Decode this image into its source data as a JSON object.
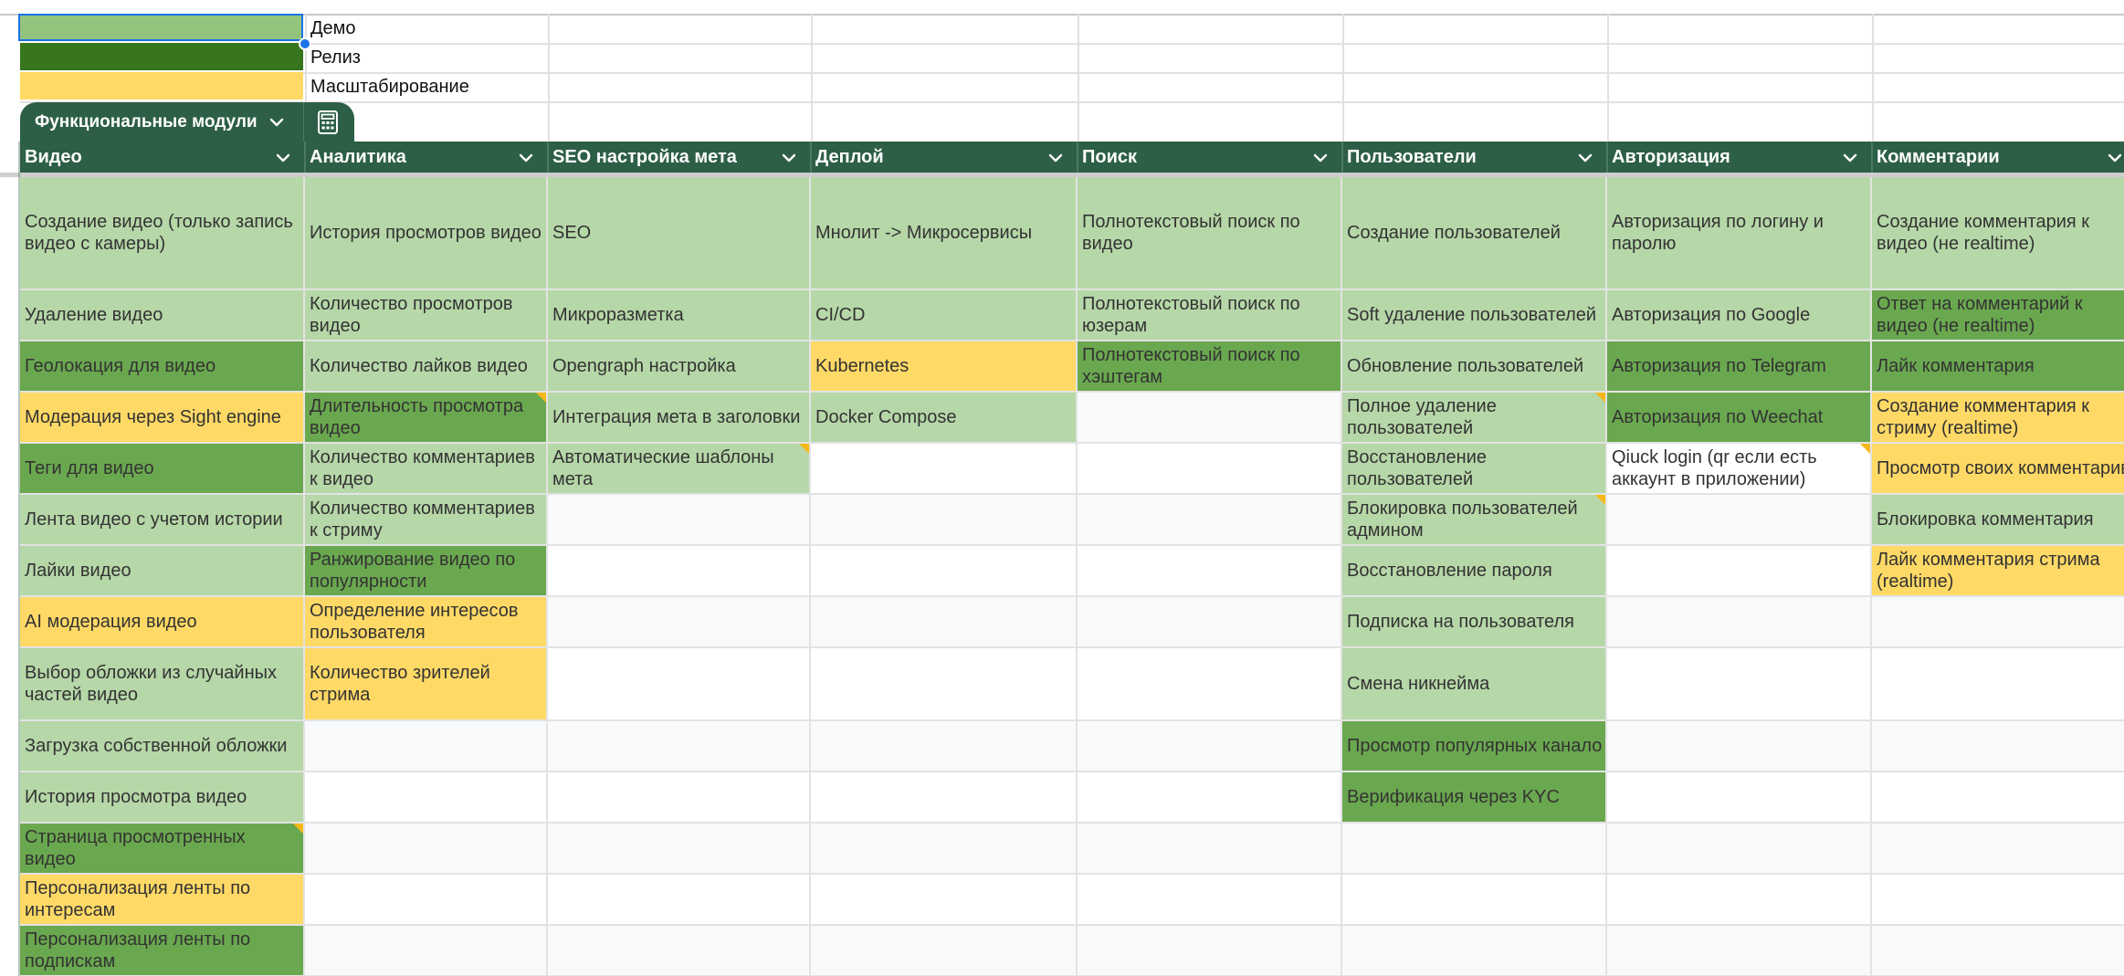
{
  "legend": [
    {
      "label": "Демо",
      "color": "#93c47d"
    },
    {
      "label": "Релиз",
      "color": "#38761d"
    },
    {
      "label": "Масштабирование",
      "color": "#ffd966"
    }
  ],
  "table": {
    "tab_label": "Функциональные модули",
    "tab_chevron_icon": "chevron-down-icon",
    "tab_calc_icon": "calculator-icon",
    "header_chevron_icon": "chevron-down-icon",
    "colors": {
      "header_bg": "#2d5f46",
      "demo": "#b6d7a8",
      "release": "#6aa84f",
      "scale": "#ffd966",
      "stripe": "#f8f9fa",
      "comment_marker": "#f6b819"
    },
    "columns": [
      "Видео",
      "Аналитика",
      "SEO настройка мета",
      "Деплой",
      "Поиск",
      "Пользователи",
      "Авторизация",
      "Комментарии"
    ],
    "rows": [
      [
        {
          "text": "Создание видео (только запись видео с камеры)",
          "status": "demo"
        },
        {
          "text": "История просмотров видео",
          "status": "demo"
        },
        {
          "text": "SEO",
          "status": "demo"
        },
        {
          "text": "Мнолит -> Микросервисы",
          "status": "demo"
        },
        {
          "text": "Полнотекстовый поиск по видео",
          "status": "demo"
        },
        {
          "text": "Создание пользователей",
          "status": "demo"
        },
        {
          "text": "Авторизация по логину и паролю",
          "status": "demo"
        },
        {
          "text": "Создание комментария к видео (не realtime)",
          "status": "demo"
        }
      ],
      [
        {
          "text": "Удаление видео",
          "status": "demo"
        },
        {
          "text": "Количество просмотров видео",
          "status": "demo"
        },
        {
          "text": "Микроразметка",
          "status": "demo"
        },
        {
          "text": "CI/CD",
          "status": "demo"
        },
        {
          "text": "Полнотекстовый поиск по юзерам",
          "status": "demo"
        },
        {
          "text": "Soft удаление пользователей",
          "status": "demo"
        },
        {
          "text": "Авторизация по Google",
          "status": "demo"
        },
        {
          "text": "Ответ на комментарий к видео (не realtime)",
          "status": "release"
        }
      ],
      [
        {
          "text": "Геолокация для видео",
          "status": "release"
        },
        {
          "text": "Количество лайков видео",
          "status": "demo"
        },
        {
          "text": "Opengraph настройка",
          "status": "demo"
        },
        {
          "text": "Kubernetes",
          "status": "scale"
        },
        {
          "text": "Полнотекстовый поиск по хэштегам",
          "status": "release"
        },
        {
          "text": "Обновление пользователей",
          "status": "demo"
        },
        {
          "text": "Авторизация по Telegram",
          "status": "release"
        },
        {
          "text": "Лайк комментария",
          "status": "release"
        }
      ],
      [
        {
          "text": "Модерация через Sight engine",
          "status": "scale"
        },
        {
          "text": "Длительность просмотра видео",
          "status": "release",
          "note": true
        },
        {
          "text": "Интеграция мета в заголовки",
          "status": "demo"
        },
        {
          "text": "Docker Compose",
          "status": "demo"
        },
        {
          "text": "",
          "status": "none"
        },
        {
          "text": "Полное удаление пользователей",
          "status": "demo",
          "note": true
        },
        {
          "text": "Авторизация по Weechat",
          "status": "release"
        },
        {
          "text": "Создание комментария к стриму (realtime)",
          "status": "scale"
        }
      ],
      [
        {
          "text": "Теги для видео",
          "status": "release"
        },
        {
          "text": "Количество комментариев к видео",
          "status": "demo"
        },
        {
          "text": "Автоматические шаблоны мета",
          "status": "demo",
          "note": true
        },
        {
          "text": "",
          "status": "none"
        },
        {
          "text": "",
          "status": "none"
        },
        {
          "text": "Восстановление пользователей",
          "status": "demo"
        },
        {
          "text": "Qiuck login (qr если есть аккаунт в приложении)",
          "status": "none",
          "note": true
        },
        {
          "text": "Просмотр своих комментарив",
          "status": "scale"
        }
      ],
      [
        {
          "text": "Лента видео с учетом истории",
          "status": "demo"
        },
        {
          "text": "Количество комментариев к стриму",
          "status": "demo"
        },
        {
          "text": "",
          "status": "none"
        },
        {
          "text": "",
          "status": "none"
        },
        {
          "text": "",
          "status": "none"
        },
        {
          "text": "Блокировка пользователей админом",
          "status": "demo",
          "note": true
        },
        {
          "text": "",
          "status": "none"
        },
        {
          "text": "Блокировка комментария",
          "status": "demo"
        }
      ],
      [
        {
          "text": "Лайки видео",
          "status": "demo"
        },
        {
          "text": "Ранжирование видео по популярности",
          "status": "release"
        },
        {
          "text": "",
          "status": "none"
        },
        {
          "text": "",
          "status": "none"
        },
        {
          "text": "",
          "status": "none"
        },
        {
          "text": "Восстановление пароля",
          "status": "demo"
        },
        {
          "text": "",
          "status": "none"
        },
        {
          "text": "Лайк комментария стрима (realtime)",
          "status": "scale"
        }
      ],
      [
        {
          "text": "AI модерация видео",
          "status": "scale"
        },
        {
          "text": "Определение интересов пользователя",
          "status": "scale"
        },
        {
          "text": "",
          "status": "none"
        },
        {
          "text": "",
          "status": "none"
        },
        {
          "text": "",
          "status": "none"
        },
        {
          "text": "Подписка на пользователя",
          "status": "demo"
        },
        {
          "text": "",
          "status": "none"
        },
        {
          "text": "",
          "status": "none"
        }
      ],
      [
        {
          "text": "Выбор обложки из случайных частей видео",
          "status": "demo"
        },
        {
          "text": "Количество зрителей стрима",
          "status": "scale"
        },
        {
          "text": "",
          "status": "none"
        },
        {
          "text": "",
          "status": "none"
        },
        {
          "text": "",
          "status": "none"
        },
        {
          "text": "Смена никнейма",
          "status": "demo"
        },
        {
          "text": "",
          "status": "none"
        },
        {
          "text": "",
          "status": "none"
        }
      ],
      [
        {
          "text": "Загрузка собственной обложки",
          "status": "demo"
        },
        {
          "text": "",
          "status": "none"
        },
        {
          "text": "",
          "status": "none"
        },
        {
          "text": "",
          "status": "none"
        },
        {
          "text": "",
          "status": "none"
        },
        {
          "text": "Просмотр популярных канало",
          "status": "release",
          "nowrap": true
        },
        {
          "text": "",
          "status": "none"
        },
        {
          "text": "",
          "status": "none"
        }
      ],
      [
        {
          "text": "История просмотра видео",
          "status": "demo"
        },
        {
          "text": "",
          "status": "none"
        },
        {
          "text": "",
          "status": "none"
        },
        {
          "text": "",
          "status": "none"
        },
        {
          "text": "",
          "status": "none"
        },
        {
          "text": "Верификация через KYC",
          "status": "release"
        },
        {
          "text": "",
          "status": "none"
        },
        {
          "text": "",
          "status": "none"
        }
      ],
      [
        {
          "text": "Страница просмотренных видео",
          "status": "release",
          "note": true
        },
        {
          "text": "",
          "status": "none"
        },
        {
          "text": "",
          "status": "none"
        },
        {
          "text": "",
          "status": "none"
        },
        {
          "text": "",
          "status": "none"
        },
        {
          "text": "",
          "status": "none"
        },
        {
          "text": "",
          "status": "none"
        },
        {
          "text": "",
          "status": "none"
        }
      ],
      [
        {
          "text": "Персонализация ленты по интересам",
          "status": "scale"
        },
        {
          "text": "",
          "status": "none"
        },
        {
          "text": "",
          "status": "none"
        },
        {
          "text": "",
          "status": "none"
        },
        {
          "text": "",
          "status": "none"
        },
        {
          "text": "",
          "status": "none"
        },
        {
          "text": "",
          "status": "none"
        },
        {
          "text": "",
          "status": "none"
        }
      ],
      [
        {
          "text": "Персонализация ленты по подпискам",
          "status": "release"
        },
        {
          "text": "",
          "status": "none"
        },
        {
          "text": "",
          "status": "none"
        },
        {
          "text": "",
          "status": "none"
        },
        {
          "text": "",
          "status": "none"
        },
        {
          "text": "",
          "status": "none"
        },
        {
          "text": "",
          "status": "none"
        },
        {
          "text": "",
          "status": "none"
        }
      ]
    ]
  }
}
